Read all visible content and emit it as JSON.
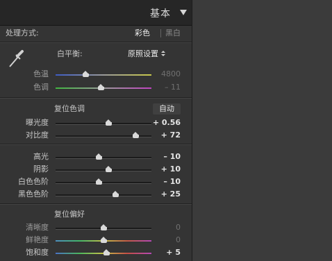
{
  "panel": {
    "title": "基本",
    "treatment": {
      "label": "处理方式:",
      "color_option": "彩色",
      "bw_option": "黑白"
    },
    "white_balance": {
      "label": "白平衡:",
      "preset": "原照设置"
    },
    "tone_section": {
      "title": "复位色调",
      "auto_label": "自动"
    },
    "presence_section": {
      "title": "复位偏好"
    },
    "wb_sliders": [
      {
        "label": "色温",
        "value": "4800",
        "position": 0.31,
        "track": "temp",
        "dim": true
      },
      {
        "label": "色调",
        "value": "– 11",
        "position": 0.47,
        "track": "tint",
        "dim": true
      }
    ],
    "tone_sliders": [
      {
        "label": "曝光度",
        "value": "+ 0.56",
        "position": 0.55,
        "dim": false
      },
      {
        "label": "对比度",
        "value": "+ 72",
        "position": 0.83,
        "dim": false
      }
    ],
    "tone_sliders_2": [
      {
        "label": "高光",
        "value": "– 10",
        "position": 0.45,
        "dim": false
      },
      {
        "label": "阴影",
        "value": "+ 10",
        "position": 0.55,
        "dim": false
      },
      {
        "label": "白色色阶",
        "value": "– 10",
        "position": 0.45,
        "dim": false
      },
      {
        "label": "黑色色阶",
        "value": "+ 25",
        "position": 0.62,
        "dim": false
      }
    ],
    "presence_sliders": [
      {
        "label": "清晰度",
        "value": "0",
        "position": 0.5,
        "track": "plain",
        "dim": true
      },
      {
        "label": "鲜艳度",
        "value": "0",
        "position": 0.5,
        "track": "vib",
        "dim": true
      },
      {
        "label": "饱和度",
        "value": "+ 5",
        "position": 0.53,
        "track": "sat",
        "dim": false
      }
    ]
  }
}
